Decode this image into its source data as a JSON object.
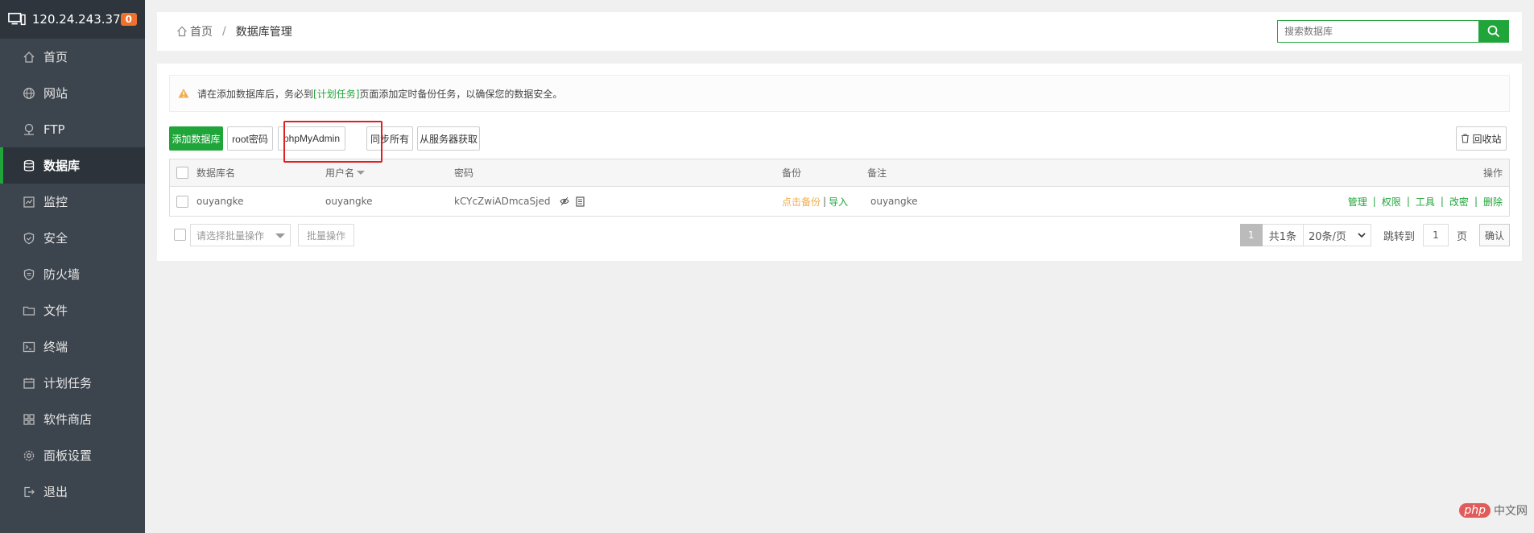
{
  "sidebar": {
    "host": "120.24.243.37",
    "badge": "0",
    "items": [
      {
        "label": "首页",
        "icon": "home-icon"
      },
      {
        "label": "网站",
        "icon": "globe-icon"
      },
      {
        "label": "FTP",
        "icon": "ftp-icon"
      },
      {
        "label": "数据库",
        "icon": "database-icon",
        "active": true
      },
      {
        "label": "监控",
        "icon": "monitor-icon"
      },
      {
        "label": "安全",
        "icon": "shield-icon"
      },
      {
        "label": "防火墙",
        "icon": "firewall-icon"
      },
      {
        "label": "文件",
        "icon": "folder-icon"
      },
      {
        "label": "终端",
        "icon": "terminal-icon"
      },
      {
        "label": "计划任务",
        "icon": "calendar-icon"
      },
      {
        "label": "软件商店",
        "icon": "apps-icon"
      },
      {
        "label": "面板设置",
        "icon": "gear-icon"
      },
      {
        "label": "退出",
        "icon": "logout-icon"
      }
    ]
  },
  "header": {
    "breadcrumb_home": "首页",
    "breadcrumb_sep": "/",
    "breadcrumb_current": "数据库管理",
    "search_placeholder": "搜索数据库"
  },
  "alert": {
    "text_before": "请在添加数据库后，务必到",
    "link": "[计划任务]",
    "text_after": "页面添加定时备份任务，以确保您的数据安全。"
  },
  "toolbar": {
    "add_db": "添加数据库",
    "root_pwd": "root密码",
    "phpmyadmin": "phpMyAdmin",
    "sync_all": "同步所有",
    "fetch_server": "从服务器获取",
    "recycle": "回收站"
  },
  "table": {
    "headers": {
      "name": "数据库名",
      "user": "用户名",
      "password": "密码",
      "backup": "备份",
      "note": "备注",
      "ops": "操作"
    },
    "rows": [
      {
        "name": "ouyangke",
        "user": "ouyangke",
        "password": "kCYcZwiADmcaSjed",
        "backup_click": "点击备份",
        "backup_sep": "|",
        "import": "导入",
        "note": "ouyangke",
        "ops": [
          "管理",
          "权限",
          "工具",
          "改密",
          "删除"
        ]
      }
    ]
  },
  "footer": {
    "batch_placeholder": "请选择批量操作",
    "batch_btn": "批量操作",
    "page_current": "1",
    "total": "共1条",
    "page_size": "20条/页",
    "jump_to": "跳转到",
    "jump_value": "1",
    "page_unit": "页",
    "confirm": "确认"
  },
  "watermark": {
    "logo": "php",
    "text": "中文网"
  },
  "colors": {
    "accent": "#20a53a",
    "sidebar_bg": "#3c444d",
    "badge": "#f0712e",
    "highlight": "#e02020",
    "warning": "#f0ad4e"
  }
}
